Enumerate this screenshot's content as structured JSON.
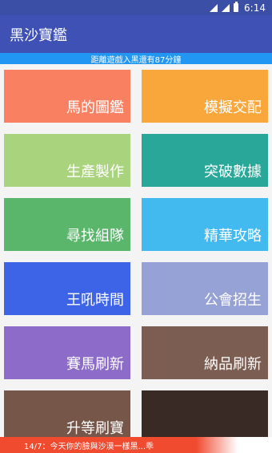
{
  "status_bar": {
    "time": "6:14",
    "icons": [
      "wifi-icon",
      "signal-icon",
      "battery-icon"
    ]
  },
  "app_bar": {
    "title": "黑沙寶鑑"
  },
  "info_strip": {
    "text": "距離遊戲入黑還有87分鐘"
  },
  "tiles": [
    {
      "label": "馬的圖鑑",
      "color": "#f98061"
    },
    {
      "label": "模擬交配",
      "color": "#f9a63b"
    },
    {
      "label": "生產製作",
      "color": "#a9d37d"
    },
    {
      "label": "突破數據",
      "color": "#29a89a"
    },
    {
      "label": "尋找組隊",
      "color": "#5ab66b"
    },
    {
      "label": "精華攻略",
      "color": "#42b9ef"
    },
    {
      "label": "王吼時間",
      "color": "#3d63e6"
    },
    {
      "label": "公會招生",
      "color": "#96a1d6"
    },
    {
      "label": "賽馬刷新",
      "color": "#8c6cc8"
    },
    {
      "label": "納品刷新",
      "color": "#7c5d52"
    },
    {
      "label": "升等刷寶",
      "color": "#77564a"
    },
    {
      "label": "",
      "color": "#3a2a25"
    }
  ],
  "ticker": {
    "text": "14/7：今天你的臉與沙漠一樣黑...乖"
  }
}
